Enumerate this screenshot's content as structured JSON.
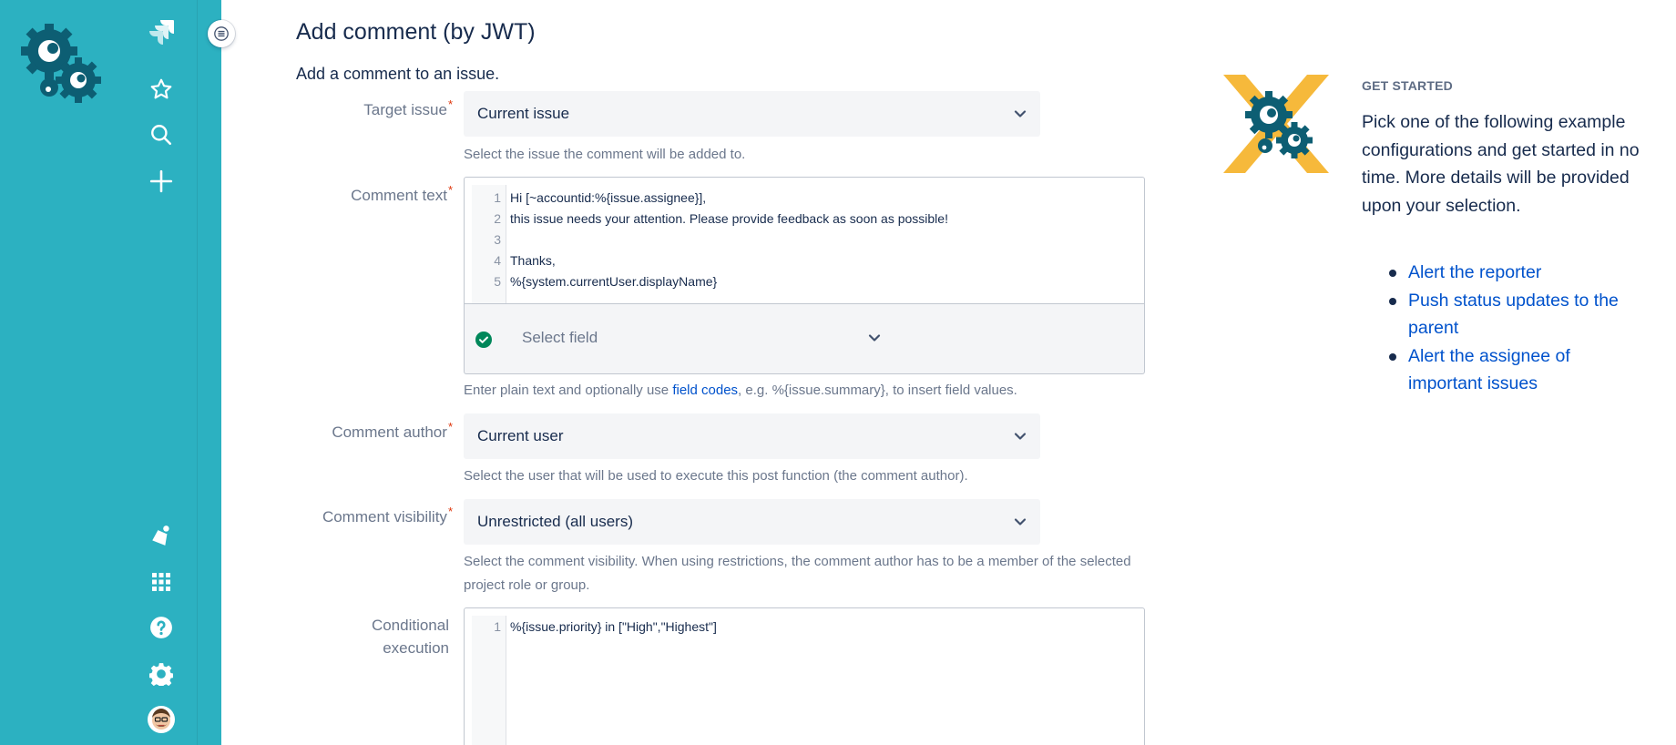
{
  "page": {
    "title": "Add comment (by JWT)",
    "description": "Add a comment to an issue."
  },
  "form": {
    "target_issue": {
      "label": "Target issue",
      "required_mark": "*",
      "value": "Current issue",
      "help": "Select the issue the comment will be added to."
    },
    "comment_text": {
      "label": "Comment text",
      "required_mark": "*",
      "lines": [
        {
          "num": "1",
          "text": "Hi [~accountid:%{issue.assignee}],"
        },
        {
          "num": "2",
          "text": "this issue needs your attention. Please provide feedback as soon as possible!"
        },
        {
          "num": "3",
          "text": ""
        },
        {
          "num": "4",
          "text": "Thanks,"
        },
        {
          "num": "5",
          "text": "%{system.currentUser.displayName}"
        }
      ],
      "field_picker_placeholder": "Select field",
      "help_prefix": "Enter plain text and optionally use ",
      "help_link": "field codes",
      "help_suffix": ", e.g. %{issue.summary}, to insert field values."
    },
    "comment_author": {
      "label": "Comment author",
      "required_mark": "*",
      "value": "Current user",
      "help": "Select the user that will be used to execute this post function (the comment author)."
    },
    "comment_visibility": {
      "label": "Comment visibility",
      "required_mark": "*",
      "value": "Unrestricted (all users)",
      "help_line1": "Select the comment visibility. When using restrictions, the comment author has to be a member of the selected",
      "help_line2": "project role or group."
    },
    "conditional_execution": {
      "label_line1": "Conditional",
      "label_line2": "execution",
      "lines": [
        {
          "num": "1",
          "text": "%{issue.priority} in [\"High\",\"Highest\"]"
        }
      ]
    }
  },
  "get_started": {
    "heading": "GET STARTED",
    "intro": "Pick one of the following example configurations and get started in no time. More details will be provided upon your selection.",
    "items": [
      "Alert the reporter",
      "Push status updates to the parent",
      "Alert the assignee of important issues"
    ]
  },
  "colors": {
    "sidebar": "#2cb1c1",
    "link": "#0052cc",
    "required": "#de350b",
    "success": "#00875a",
    "logo_gear": "#0d5e73",
    "logo_x": "#f6b93b"
  },
  "icons": {
    "global_nav_top": [
      "jira-icon",
      "star-icon",
      "search-icon",
      "plus-icon"
    ],
    "global_nav_bottom": [
      "notification-icon",
      "app-switcher-icon",
      "help-icon",
      "settings-icon",
      "avatar"
    ]
  }
}
